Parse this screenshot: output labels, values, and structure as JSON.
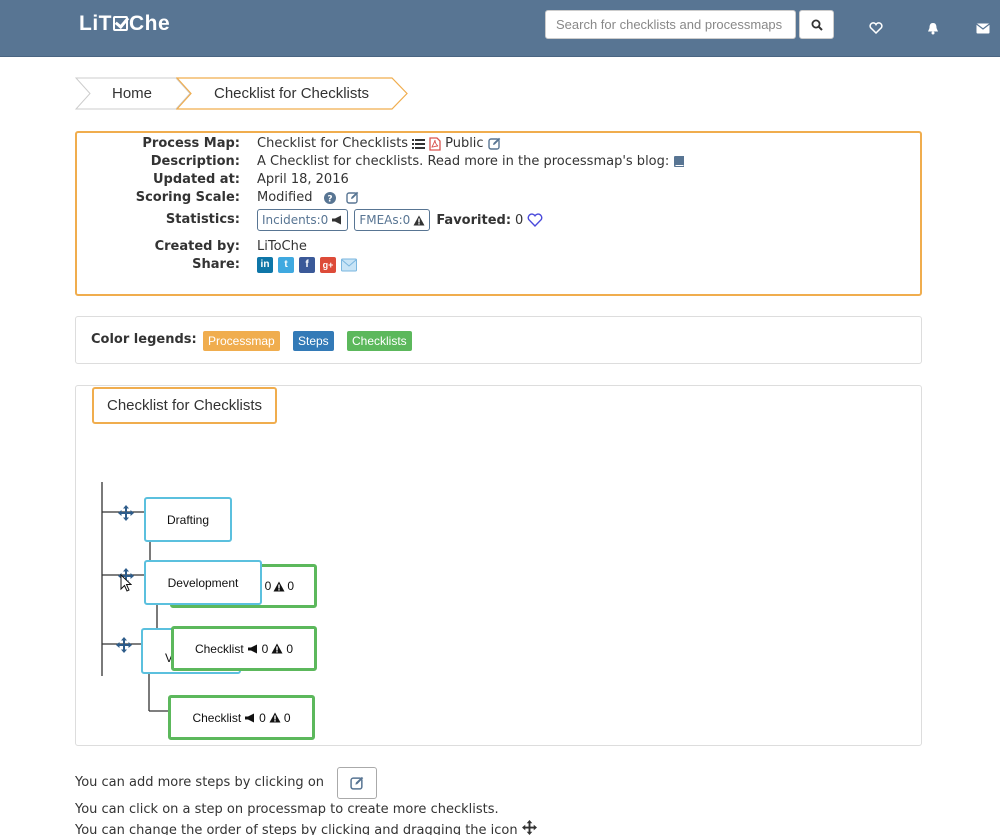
{
  "navbar": {
    "brand_prefix": "LiT",
    "brand_suffix": "Che",
    "search_placeholder": "Search for checklists and processmaps"
  },
  "breadcrumb": {
    "items": [
      {
        "label": "Home"
      },
      {
        "label": "Checklist for Checklists"
      }
    ]
  },
  "info": {
    "process_map_label": "Process Map:",
    "process_map_value": "Checklist for Checklists",
    "visibility": "Public",
    "description_label": "Description:",
    "description_value": "A Checklist for checklists. Read more in the processmap's blog:",
    "updated_label": "Updated at:",
    "updated_value": "April 18, 2016",
    "scoring_label": "Scoring Scale:",
    "scoring_value": "Modified",
    "statistics_label": "Statistics:",
    "incidents": "Incidents:0",
    "fmeas": "FMEAs:0",
    "favorited_label": "Favorited:",
    "favorited_count": "0",
    "created_label": "Created by:",
    "created_value": "LiToChe",
    "share_label": "Share:"
  },
  "legend": {
    "label": "Color legends:",
    "tags": [
      {
        "label": "Processmap",
        "color": "#f0ad4e"
      },
      {
        "label": "Steps",
        "color": "#337ab7"
      },
      {
        "label": "Checklists",
        "color": "#5cb85c"
      }
    ]
  },
  "map": {
    "title": "Checklist for Checklists",
    "steps": [
      {
        "label": "Drafting"
      },
      {
        "label": "Development"
      }
    ],
    "checklists": [
      {
        "label": "Checklist",
        "incidents": "0",
        "fmeas": "0"
      },
      {
        "label": "Checklist",
        "incidents": "0",
        "fmeas": "0"
      },
      {
        "label": "Checklist",
        "incidents": "0",
        "fmeas": "0"
      }
    ],
    "hidden_fragment": "V"
  },
  "help": {
    "line1": "You can add more steps by clicking on",
    "line2": "You can click on a step on processmap to create more checklists.",
    "line3": "You can change the order of steps by clicking and dragging the icon"
  },
  "colors": {
    "navbar": "#587593",
    "processmap": "#f0ad4e",
    "step": "#5bc0de",
    "checklist": "#5cb85c"
  }
}
